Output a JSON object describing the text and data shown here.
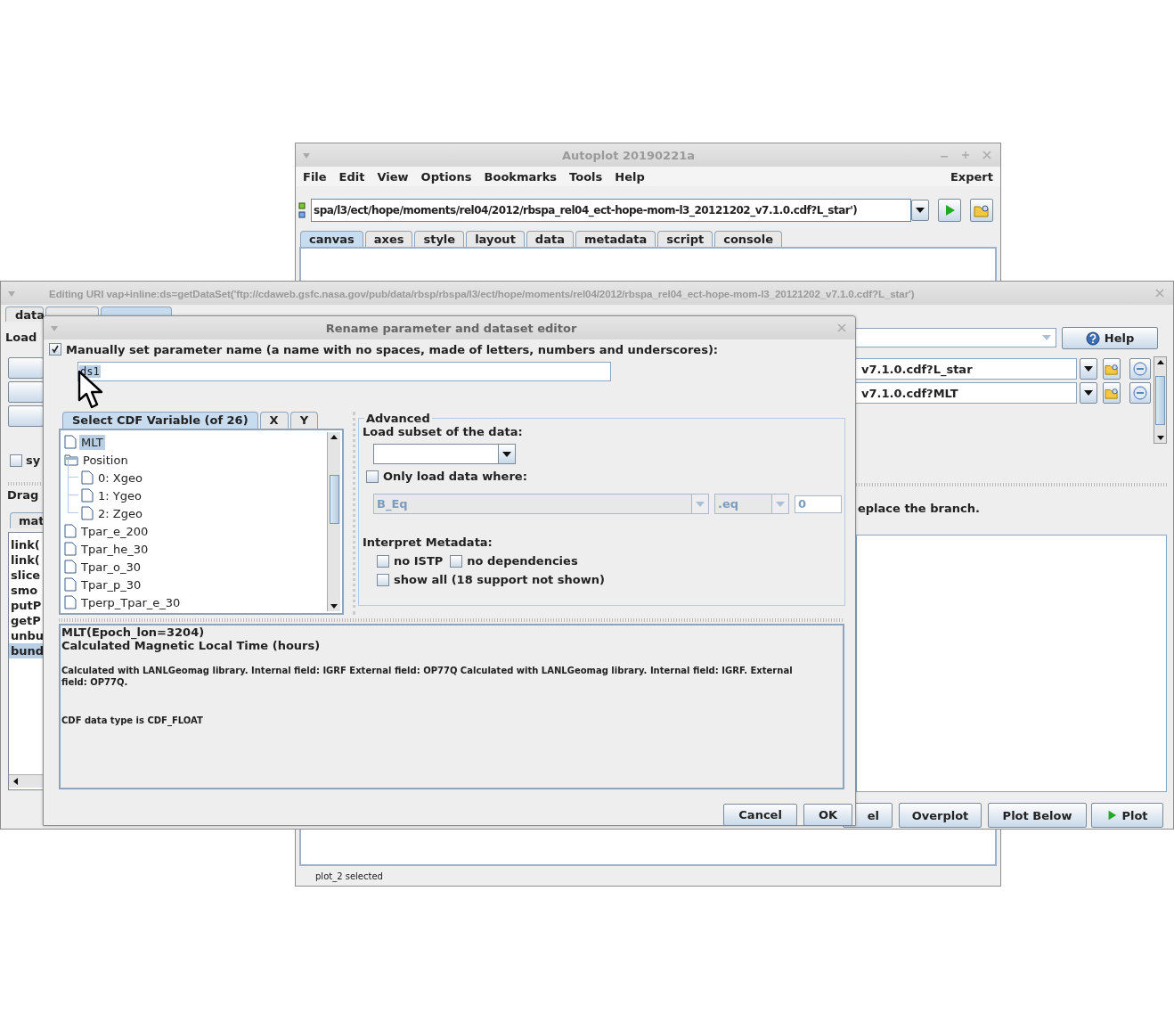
{
  "main_window": {
    "title": "Autoplot 20190221a",
    "menu": [
      "File",
      "Edit",
      "View",
      "Options",
      "Bookmarks",
      "Tools",
      "Help"
    ],
    "mode": "Expert",
    "uri": "spa/l3/ect/hope/moments/rel04/2012/rbspa_rel04_ect-hope-mom-l3_20121202_v7.1.0.cdf?L_star')",
    "tabs": [
      {
        "label": "canvas",
        "selected": true
      },
      {
        "label": "axes",
        "selected": false
      },
      {
        "label": "style",
        "selected": false
      },
      {
        "label": "layout",
        "selected": false
      },
      {
        "label": "data",
        "selected": false
      },
      {
        "label": "metadata",
        "selected": false
      },
      {
        "label": "script",
        "selected": false
      },
      {
        "label": "console",
        "selected": false
      }
    ],
    "status": "plot_2 selected"
  },
  "editor_window": {
    "title": "Editing URI vap+inline:ds=getDataSet('ftp://cdaweb.gsfc.nasa.gov/pub/data/rbsp/rbspa/l3/ect/hope/moments/rel04/2012/rbspa_rel04_ect-hope-mom-l3_20121202_v7.1.0.cdf?L_star')",
    "tabs": [
      {
        "label": "data",
        "selected": false
      },
      {
        "selected": false
      },
      {
        "selected": true
      }
    ],
    "load_label": "Load",
    "help_button": "Help",
    "uri_rows": [
      "v7.1.0.cdf?L_star",
      "v7.1.0.cdf?MLT"
    ],
    "sync_checkbox": {
      "label": "sy",
      "checked": false
    },
    "drag_label": "Drag",
    "list_tab": "mat",
    "list_items": [
      {
        "text": "link(",
        "selected": false
      },
      {
        "text": "link(",
        "selected": false
      },
      {
        "text": "slice",
        "selected": false
      },
      {
        "text": "smo",
        "selected": false
      },
      {
        "text": "putP",
        "selected": false
      },
      {
        "text": "getP",
        "selected": false
      },
      {
        "text": "unbu",
        "selected": false
      },
      {
        "text": "bund",
        "selected": true
      }
    ],
    "hint": "eplace the branch.",
    "buttons": [
      {
        "label": "el",
        "kind": "plain"
      },
      {
        "label": "Overplot",
        "kind": "plain"
      },
      {
        "label": "Plot Below",
        "kind": "plain"
      },
      {
        "label": "Plot",
        "kind": "play"
      }
    ]
  },
  "dialog": {
    "title": "Rename parameter and dataset editor",
    "manual_name": {
      "label": "Manually set parameter name (a name with no spaces, made of letters, numbers and underscores):",
      "checked": true,
      "value": "ds1"
    },
    "variable_tabs": [
      {
        "label": "Select CDF Variable (of 26)",
        "selected": true
      },
      {
        "label": "X",
        "selected": false
      },
      {
        "label": "Y",
        "selected": false
      }
    ],
    "tree": [
      {
        "label": "MLT",
        "kind": "file",
        "selected": true
      },
      {
        "label": "Position",
        "kind": "folder",
        "selected": false,
        "children": [
          {
            "label": "0: Xgeo",
            "kind": "file",
            "selected": false
          },
          {
            "label": "1: Ygeo",
            "kind": "file",
            "selected": false
          },
          {
            "label": "2: Zgeo",
            "kind": "file",
            "selected": false
          }
        ]
      },
      {
        "label": "Tpar_e_200",
        "kind": "file",
        "selected": false
      },
      {
        "label": "Tpar_he_30",
        "kind": "file",
        "selected": false
      },
      {
        "label": "Tpar_o_30",
        "kind": "file",
        "selected": false
      },
      {
        "label": "Tpar_p_30",
        "kind": "file",
        "selected": false
      },
      {
        "label": "Tperp_Tpar_e_30",
        "kind": "file",
        "selected": false
      }
    ],
    "advanced": {
      "title": "Advanced",
      "subset_label": "Load subset of the data:",
      "where": {
        "label": "Only load data where:",
        "checked": false,
        "disabled": true,
        "variable": "B_Eq",
        "operator": ".eq",
        "value": "0"
      },
      "metadata_label": "Interpret Metadata:",
      "options": [
        {
          "label": "no ISTP",
          "checked": false
        },
        {
          "label": "no dependencies",
          "checked": false
        },
        {
          "label": "show all (18 support not shown)",
          "checked": false
        }
      ]
    },
    "description": {
      "signature": "MLT(Epoch_lon=3204)",
      "title": "Calculated Magnetic Local Time (hours)",
      "notes": "Calculated with LANLGeomag library. Internal field: IGRF External field: OP77Q Calculated with LANLGeomag library. Internal field: IGRF. External field: OP77Q.",
      "type_note": "CDF data type is CDF_FLOAT"
    },
    "buttons": [
      "Cancel",
      "OK"
    ]
  }
}
